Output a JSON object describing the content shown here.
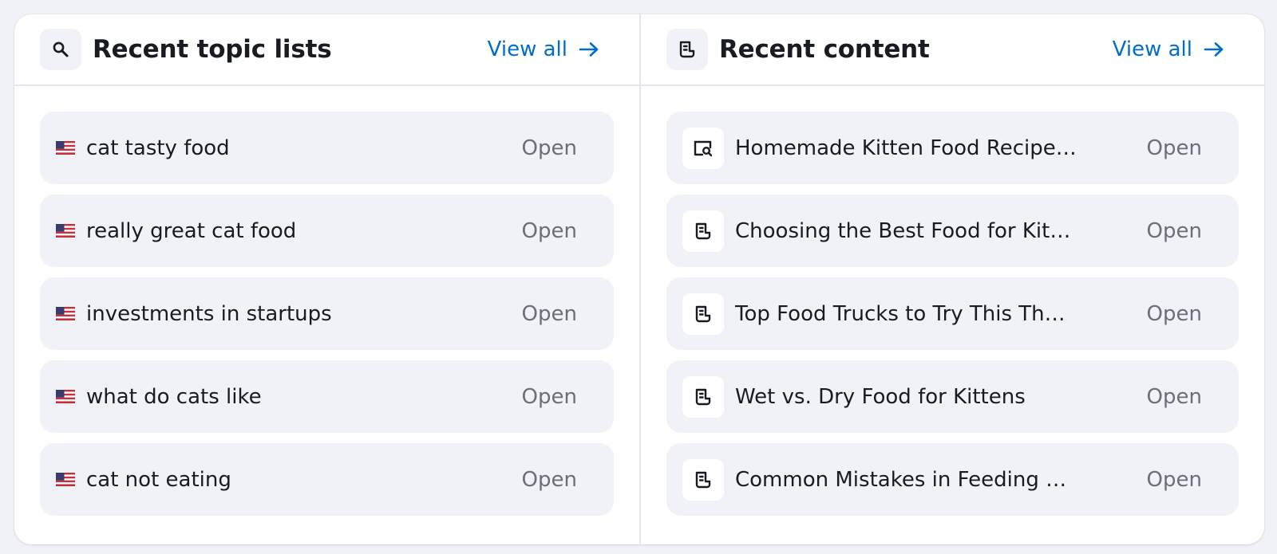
{
  "colors": {
    "background": "#f1f2f7",
    "card": "#ffffff",
    "row_bg": "#f1f2f7",
    "link": "#006dca",
    "text": "#191b23",
    "muted": "#6c6e79"
  },
  "topics": {
    "header_icon": "search-icon",
    "title": "Recent topic lists",
    "view_all": "View all",
    "items": [
      {
        "flag": "us-flag",
        "label": "cat tasty food",
        "action": "Open"
      },
      {
        "flag": "us-flag",
        "label": "really great cat food",
        "action": "Open"
      },
      {
        "flag": "us-flag",
        "label": "investments in startups",
        "action": "Open"
      },
      {
        "flag": "us-flag",
        "label": "what do cats like",
        "action": "Open"
      },
      {
        "flag": "us-flag",
        "label": "cat not eating",
        "action": "Open"
      }
    ]
  },
  "content": {
    "header_icon": "document-icon",
    "title": "Recent content",
    "view_all": "View all",
    "items": [
      {
        "icon": "document-search-icon",
        "label": "Homemade Kitten Food Recipes...",
        "action": "Open"
      },
      {
        "icon": "document-icon",
        "label": "Choosing the Best Food for Kitte...",
        "action": "Open"
      },
      {
        "icon": "document-icon",
        "label": "Top Food Trucks to Try This Thur...",
        "action": "Open"
      },
      {
        "icon": "document-icon",
        "label": "Wet vs. Dry Food for Kittens",
        "action": "Open"
      },
      {
        "icon": "document-icon",
        "label": "Common Mistakes in Feeding Kit...",
        "action": "Open"
      }
    ]
  }
}
